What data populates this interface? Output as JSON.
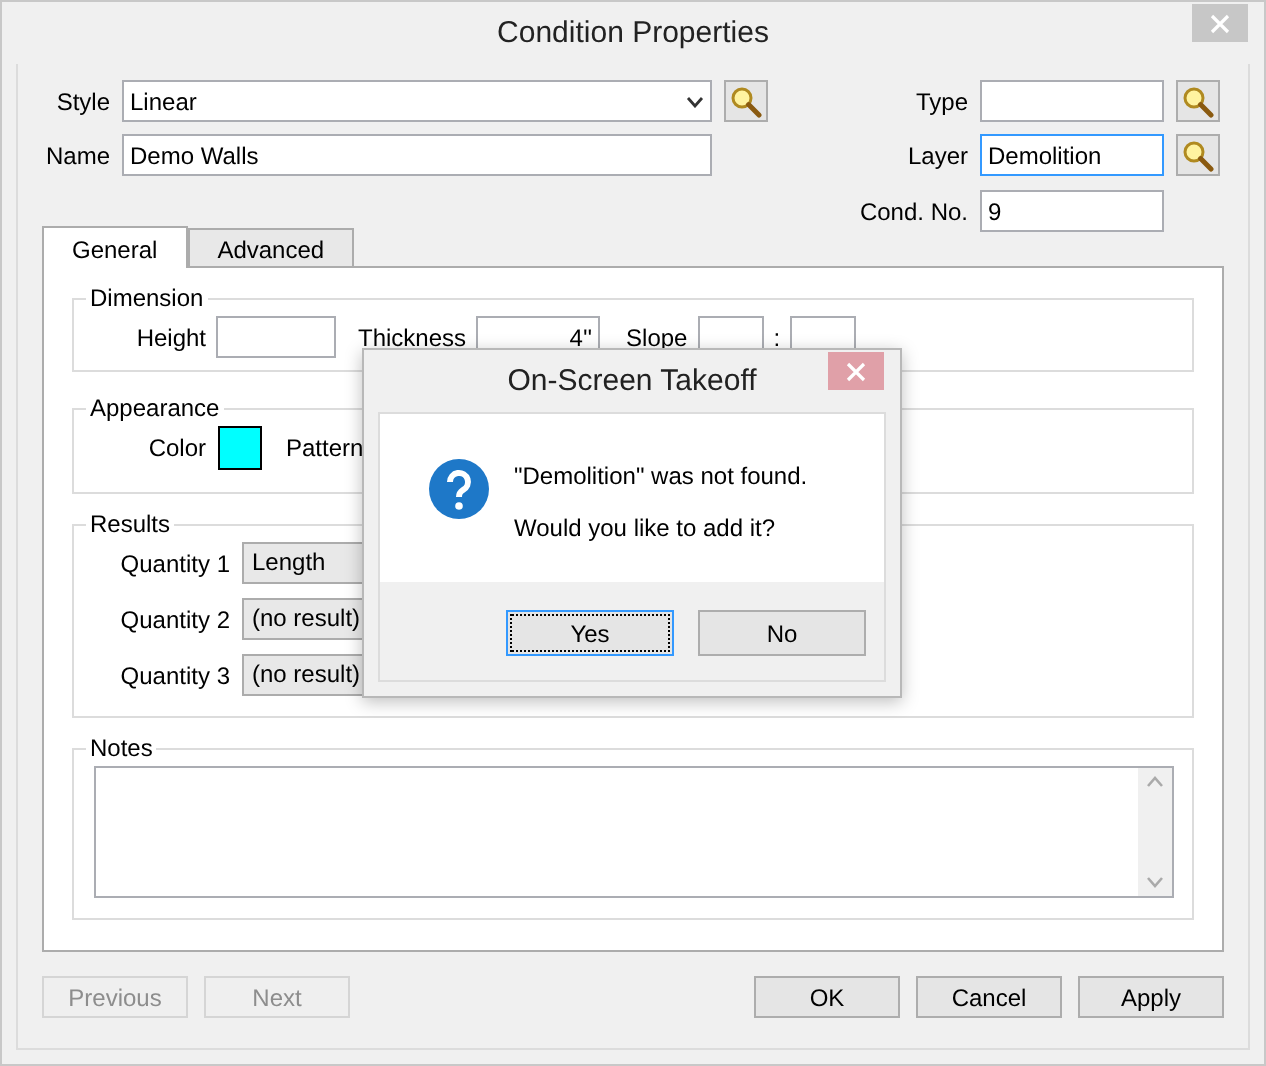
{
  "window": {
    "title": "Condition Properties"
  },
  "fields": {
    "style": {
      "label": "Style",
      "value": "Linear",
      "focused": false
    },
    "name": {
      "label": "Name",
      "value": "Demo Walls",
      "focused": false
    },
    "type": {
      "label": "Type",
      "focused": false
    },
    "layer": {
      "label": "Layer",
      "value": "Demolition",
      "focused": true
    },
    "cond_no": {
      "label": "Cond. No.",
      "value": "9",
      "focused": false
    }
  },
  "tabs": [
    {
      "label": "General",
      "selected": true
    },
    {
      "label": "Advanced",
      "selected": false
    }
  ],
  "dimension": {
    "title": "Dimension",
    "height_label": "Height",
    "thickness_label": "Thickness",
    "thickness_value": "4''",
    "slope_label": "Slope",
    "slope_separator": ":"
  },
  "appearance": {
    "title": "Appearance",
    "color_label": "Color",
    "color": "#00ffff",
    "pattern_label": "Pattern"
  },
  "results": {
    "title": "Results",
    "quantities": [
      {
        "label": "Quantity 1",
        "value": "Length"
      },
      {
        "label": "Quantity 2",
        "value": "(no result)"
      },
      {
        "label": "Quantity 3",
        "value": "(no result)"
      }
    ]
  },
  "notes": {
    "title": "Notes"
  },
  "nav_buttons": [
    {
      "label": "Previous",
      "disabled": true
    },
    {
      "label": "Next",
      "disabled": true
    }
  ],
  "buttons": [
    {
      "label": "OK"
    },
    {
      "label": "Cancel"
    },
    {
      "label": "Apply"
    }
  ],
  "message_box": {
    "title": "On-Screen Takeoff",
    "lines": [
      "\"Demolition\" was not found.",
      "Would you like to add it?"
    ],
    "buttons": [
      {
        "label": "Yes",
        "focused": true
      },
      {
        "label": "No",
        "focused": false
      }
    ]
  }
}
